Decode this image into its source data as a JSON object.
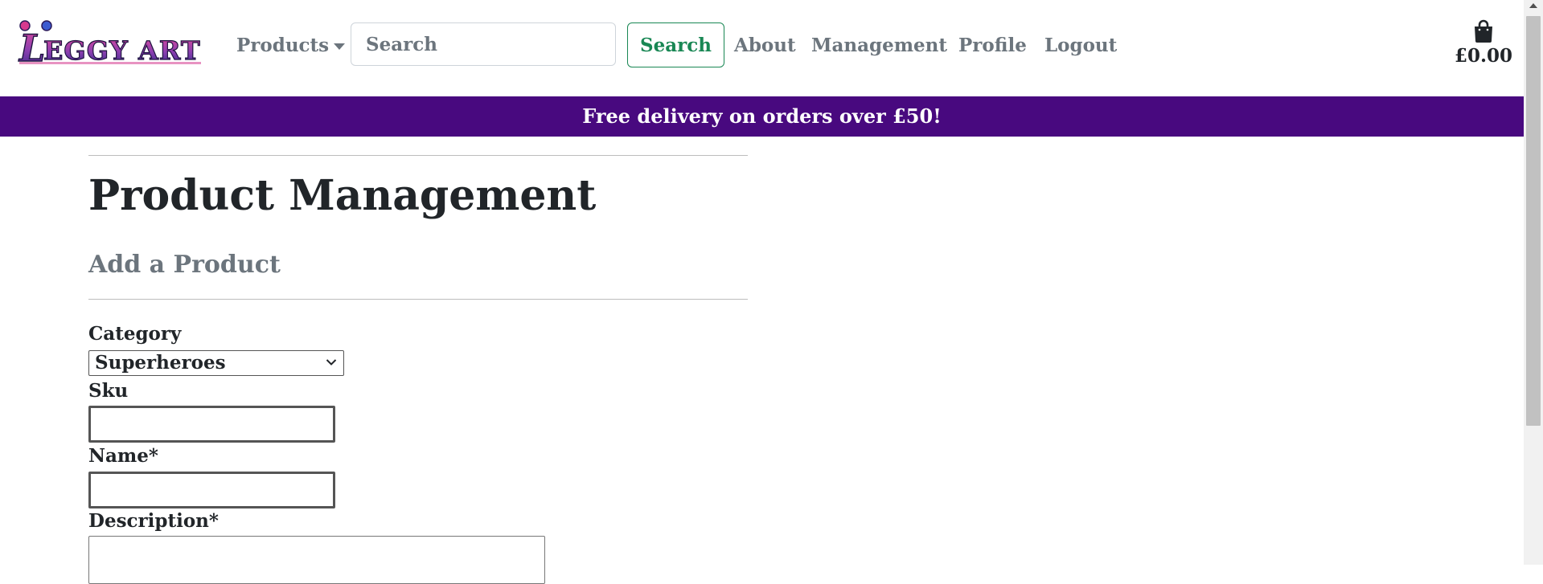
{
  "header": {
    "logo_text": "LEGGY ART",
    "nav": {
      "products_label": "Products",
      "about_label": "About",
      "management_label": "Management",
      "profile_label": "Profile",
      "logout_label": "Logout"
    },
    "search": {
      "placeholder": "Search",
      "value": "",
      "button_label": "Search"
    },
    "cart": {
      "icon": "shopping-bag-icon",
      "total": "£0.00"
    }
  },
  "banner": {
    "text": "Free delivery on orders over £50!",
    "color": "#48097f"
  },
  "main": {
    "page_title": "Product Management",
    "section_title": "Add a Product",
    "form": {
      "category_label": "Category",
      "category_value": "Superheroes",
      "sku_label": "Sku",
      "sku_value": "",
      "name_label": "Name*",
      "name_value": "",
      "description_label": "Description*",
      "description_value": ""
    }
  },
  "colors": {
    "brand_purple": "#48097f",
    "search_green": "#198754",
    "muted_text": "#6c757d"
  }
}
